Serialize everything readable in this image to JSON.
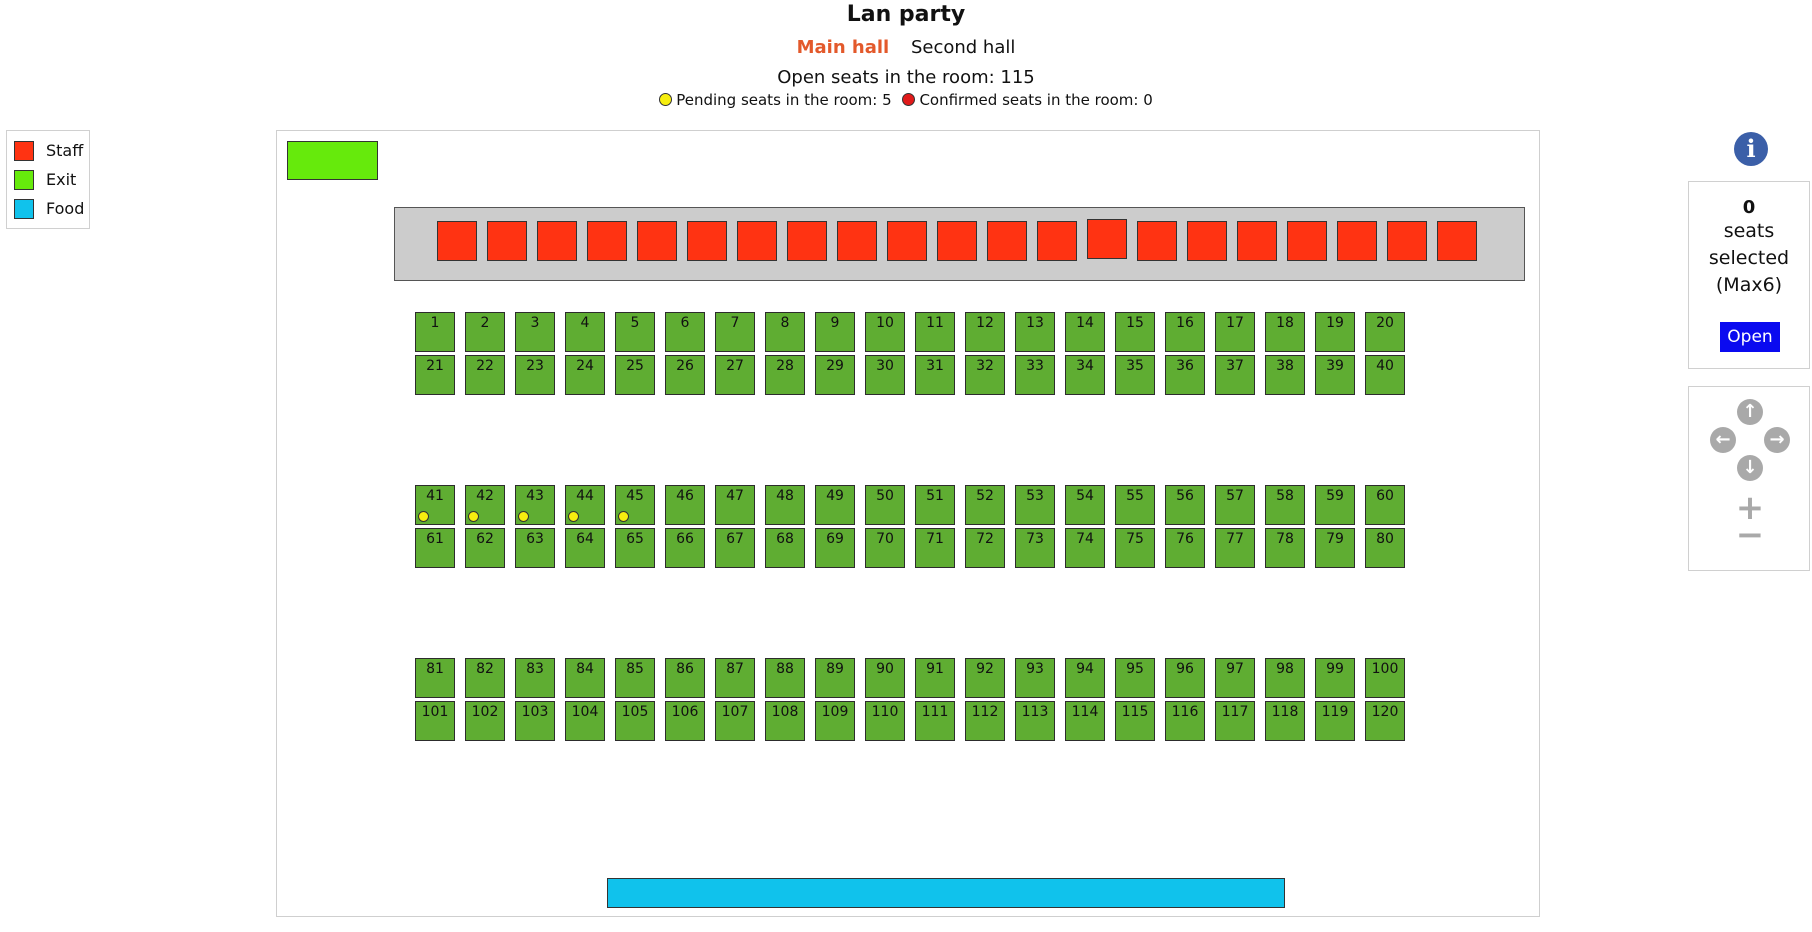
{
  "page": {
    "title": "Lan party",
    "tabs": [
      {
        "label": "Main hall",
        "active": true
      },
      {
        "label": "Second hall",
        "active": false
      }
    ],
    "open_seats_text": "Open seats in the room: 115",
    "pending_text": "Pending seats in the room: 5",
    "confirmed_text": "Confirmed seats in the room: 0"
  },
  "legend": [
    {
      "label": "Staff",
      "color": "#ff3312"
    },
    {
      "label": "Exit",
      "color": "#66ea0c"
    },
    {
      "label": "Food",
      "color": "#10c2ec"
    }
  ],
  "colors": {
    "staff": "#ff3312",
    "exit": "#66ea0c",
    "food": "#10c2ec",
    "seat_open": "#5fad32",
    "pending": "#f6ee0f",
    "confirmed": "#e11a1a",
    "active_tab": "#e3592b",
    "open_button": "#0a0af0"
  },
  "staff_seat_count": 21,
  "seats": {
    "first_number": 1,
    "last_number": 120,
    "pending": [
      41,
      42,
      43,
      44,
      45
    ]
  },
  "selection": {
    "count": "0",
    "label": "seats selected (Max6)",
    "button": "Open"
  },
  "icons": {
    "info": "info-icon",
    "up": "arrow-up-icon",
    "left": "arrow-left-icon",
    "right": "arrow-right-icon",
    "down": "arrow-down-icon",
    "zoom_in": "plus-icon",
    "zoom_out": "minus-icon"
  }
}
